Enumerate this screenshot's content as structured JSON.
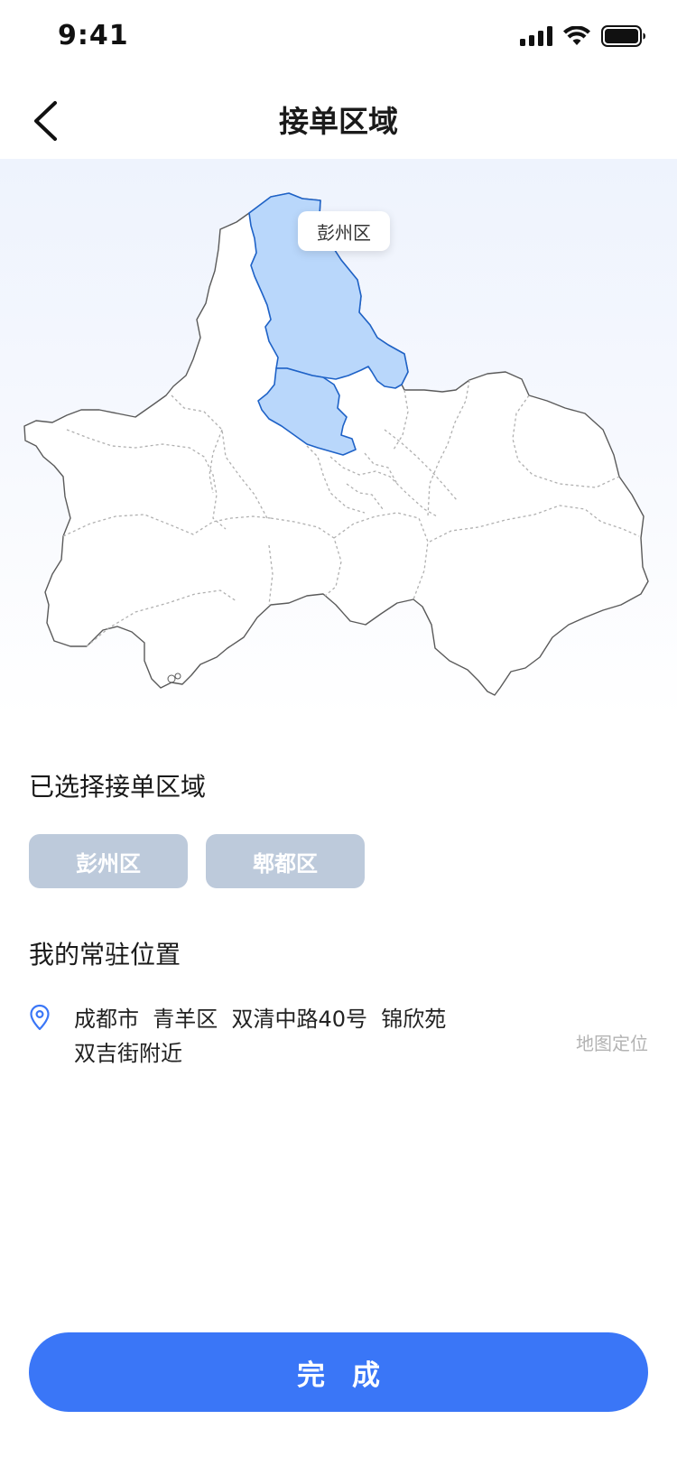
{
  "status_bar": {
    "time": "9:41"
  },
  "nav": {
    "title": "接单区域"
  },
  "map": {
    "tooltip": "彭州区",
    "selected_fill": "#b9d7fb",
    "selected_stroke": "#1e62c7"
  },
  "selected": {
    "title": "已选择接单区域",
    "chips": [
      "彭州区",
      "郫都区"
    ]
  },
  "residence": {
    "title": "我的常驻位置",
    "address_line1": "成都市  青羊区  双清中路40号  锦欣苑",
    "address_line2": "双吉街附近",
    "locate_label": "地图定位"
  },
  "footer": {
    "done_label": "完成"
  },
  "colors": {
    "accent": "#3a76f7",
    "chip": "#bdcadb"
  }
}
